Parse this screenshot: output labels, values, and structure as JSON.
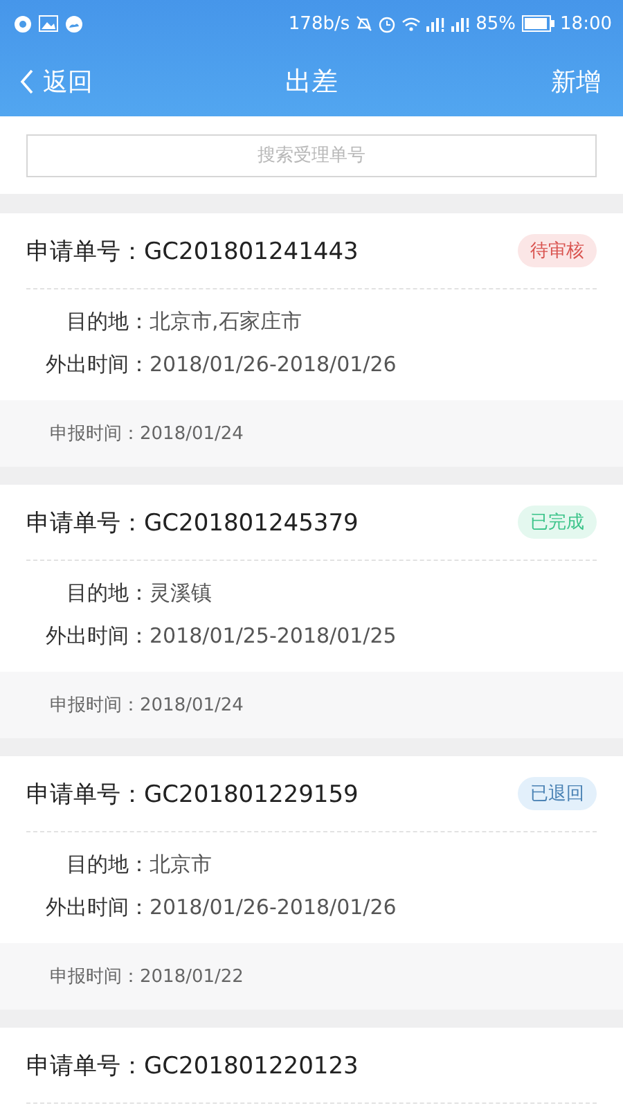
{
  "status_bar": {
    "speed": "178b/s",
    "battery": "85%",
    "time": "18:00"
  },
  "header": {
    "back": "返回",
    "title": "出差",
    "action": "新增"
  },
  "search": {
    "placeholder": "搜索受理单号"
  },
  "records": [
    {
      "number_label": "申请单号：",
      "number": "GC201801241443",
      "status": {
        "label": "待审核",
        "kind": "pending"
      },
      "fields": [
        {
          "label": "目的地：",
          "value": "北京市,石家庄市"
        },
        {
          "label": "外出时间：",
          "value": "2018/01/26-2018/01/26"
        }
      ],
      "footer": {
        "label": "申报时间：",
        "value": "2018/01/24"
      }
    },
    {
      "number_label": "申请单号：",
      "number": "GC201801245379",
      "status": {
        "label": "已完成",
        "kind": "done"
      },
      "fields": [
        {
          "label": "目的地：",
          "value": "灵溪镇"
        },
        {
          "label": "外出时间：",
          "value": "2018/01/25-2018/01/25"
        }
      ],
      "footer": {
        "label": "申报时间：",
        "value": "2018/01/24"
      }
    },
    {
      "number_label": "申请单号：",
      "number": "GC201801229159",
      "status": {
        "label": "已退回",
        "kind": "returned"
      },
      "fields": [
        {
          "label": "目的地：",
          "value": "北京市"
        },
        {
          "label": "外出时间：",
          "value": "2018/01/26-2018/01/26"
        }
      ],
      "footer": {
        "label": "申报时间：",
        "value": "2018/01/22"
      }
    },
    {
      "number_label": "申请单号：",
      "number": "GC201801220123"
    }
  ]
}
